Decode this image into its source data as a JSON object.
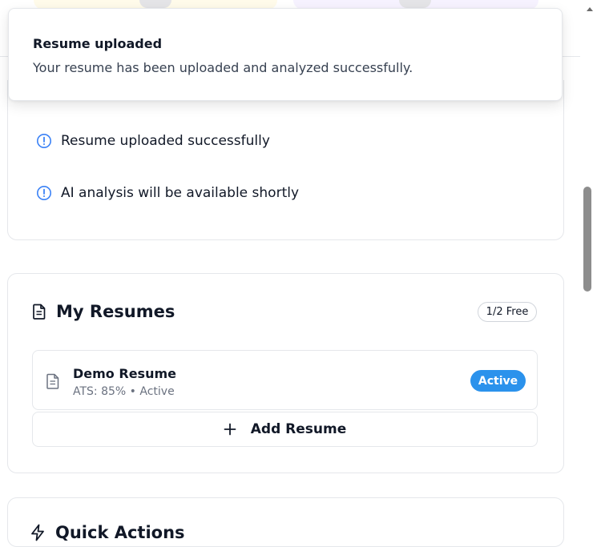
{
  "toast": {
    "title": "Resume uploaded",
    "description": "Your resume has been uploaded and analyzed successfully."
  },
  "analysis": {
    "items": [
      {
        "text": "Resume uploaded successfully",
        "icon": "info-circle-icon"
      },
      {
        "text": "AI analysis will be available shortly",
        "icon": "info-circle-icon"
      }
    ]
  },
  "resumes": {
    "title": "My Resumes",
    "title_icon": "document-icon",
    "plan_badge": "1/2 Free",
    "items": [
      {
        "name": "Demo Resume",
        "meta": "ATS: 85% • Active",
        "status": "Active",
        "icon": "file-text-icon"
      }
    ],
    "add_label": "Add Resume"
  },
  "quick_actions": {
    "title": "Quick Actions",
    "icon": "lightning-icon"
  },
  "colors": {
    "accent": "#2b92ec",
    "info_icon": "#3b82f6",
    "border": "#e5e7eb",
    "muted_text": "#6b7280"
  }
}
